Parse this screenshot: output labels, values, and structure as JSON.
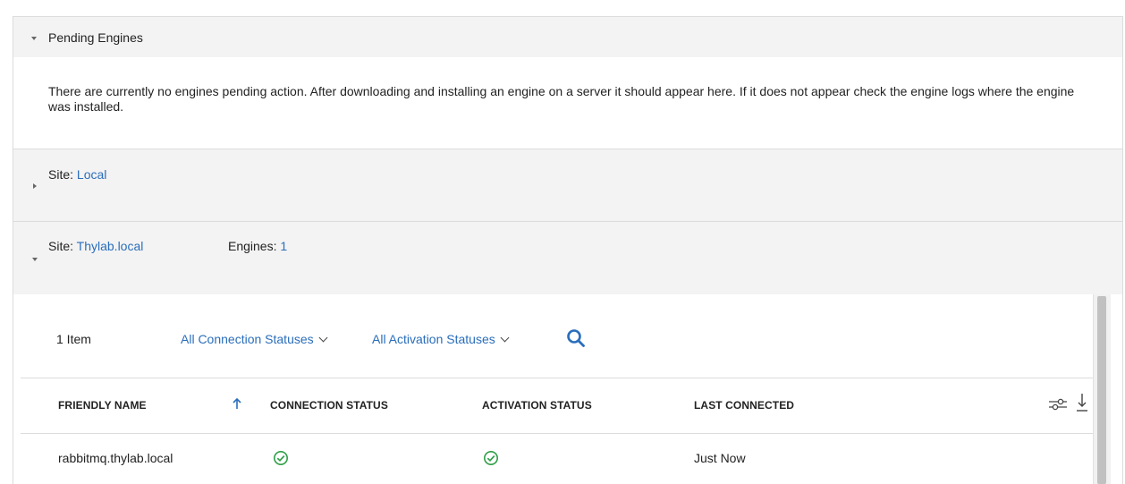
{
  "pending": {
    "title": "Pending Engines",
    "message": "There are currently no engines pending action. After downloading and installing an engine on a server it should appear here. If it does not appear check the engine logs where the engine was installed."
  },
  "sites": [
    {
      "label": "Site:",
      "name": "Local"
    },
    {
      "label": "Site:",
      "name": "Thylab.local",
      "engines_label": "Engines:",
      "engines_count": "1"
    }
  ],
  "toolbar": {
    "count": "1 Item",
    "connection_filter": "All Connection Statuses",
    "activation_filter": "All Activation Statuses"
  },
  "table": {
    "columns": [
      "FRIENDLY NAME",
      "CONNECTION STATUS",
      "ACTIVATION STATUS",
      "LAST CONNECTED"
    ],
    "rows": [
      {
        "friendly_name": "rabbitmq.thylab.local",
        "last_connected": "Just Now"
      }
    ]
  },
  "colors": {
    "link": "#2a6ebb",
    "status_ok": "#2e9e46"
  },
  "icons": [
    "sort-ascending-icon",
    "search-icon",
    "column-settings-icon",
    "download-icon",
    "check-circle-icon"
  ]
}
